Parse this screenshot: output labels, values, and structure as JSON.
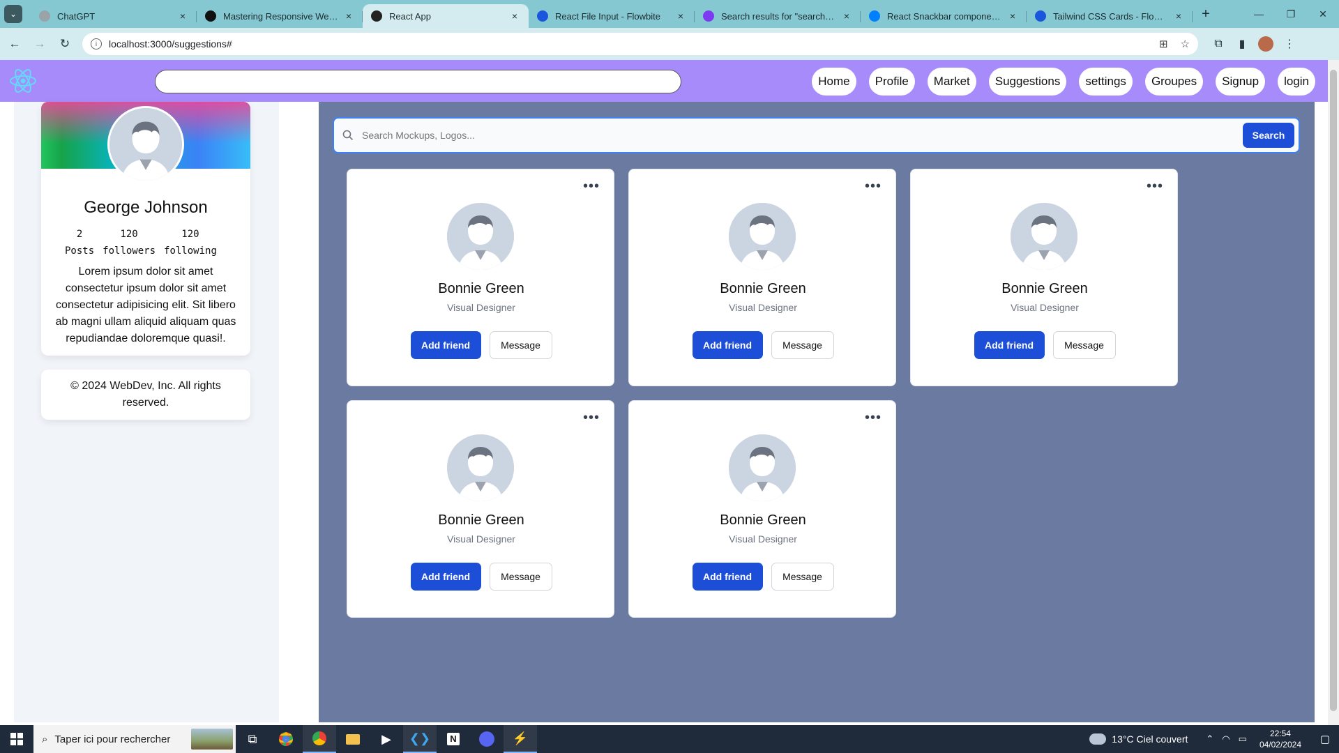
{
  "browser": {
    "tabs": [
      {
        "label": "ChatGPT",
        "favicon_color": "#9aa3a8",
        "active": false
      },
      {
        "label": "Mastering Responsive Web De",
        "favicon_color": "#111111",
        "active": false
      },
      {
        "label": "React App",
        "favicon_color": "#222222",
        "active": true
      },
      {
        "label": "React File Input - Flowbite",
        "favicon_color": "#1a56db",
        "active": false
      },
      {
        "label": "Search results for \"search\": UI E",
        "favicon_color": "#7e3af2",
        "active": false
      },
      {
        "label": "React Snackbar component - M",
        "favicon_color": "#007fff",
        "active": false
      },
      {
        "label": "Tailwind CSS Cards - Flowbite",
        "favicon_color": "#1a56db",
        "active": false
      }
    ],
    "close_glyph": "×",
    "new_tab_glyph": "+",
    "url": "localhost:3000/suggestions#"
  },
  "app": {
    "nav_links": [
      "Home",
      "Profile",
      "Market",
      "Suggestions",
      "settings",
      "Groupes",
      "Signup",
      "login"
    ],
    "profile": {
      "name": "George Johnson",
      "stats": [
        {
          "value": "2",
          "label": "Posts"
        },
        {
          "value": "120",
          "label": "followers"
        },
        {
          "value": "120",
          "label": "following"
        }
      ],
      "bio": "Lorem ipsum dolor sit amet consectetur ipsum dolor sit amet consectetur adipisicing elit. Sit libero ab magni ullam aliquid aliquam quas repudiandae doloremque quasi!."
    },
    "footer": "© 2024 WebDev, Inc. All rights reserved.",
    "search": {
      "placeholder": "Search Mockups, Logos...",
      "button": "Search"
    },
    "suggestions": [
      {
        "name": "Bonnie Green",
        "role": "Visual Designer",
        "add_label": "Add friend",
        "message_label": "Message"
      },
      {
        "name": "Bonnie Green",
        "role": "Visual Designer",
        "add_label": "Add friend",
        "message_label": "Message"
      },
      {
        "name": "Bonnie Green",
        "role": "Visual Designer",
        "add_label": "Add friend",
        "message_label": "Message"
      },
      {
        "name": "Bonnie Green",
        "role": "Visual Designer",
        "add_label": "Add friend",
        "message_label": "Message"
      },
      {
        "name": "Bonnie Green",
        "role": "Visual Designer",
        "add_label": "Add friend",
        "message_label": "Message"
      }
    ],
    "colors": {
      "nav_bg": "#a78bfa",
      "main_bg": "#6b7aa1",
      "primary": "#1d4ed8"
    }
  },
  "taskbar": {
    "search_placeholder": "Taper ici pour rechercher",
    "weather": "13°C  Ciel couvert",
    "time": "22:54",
    "date": "04/02/2024"
  }
}
